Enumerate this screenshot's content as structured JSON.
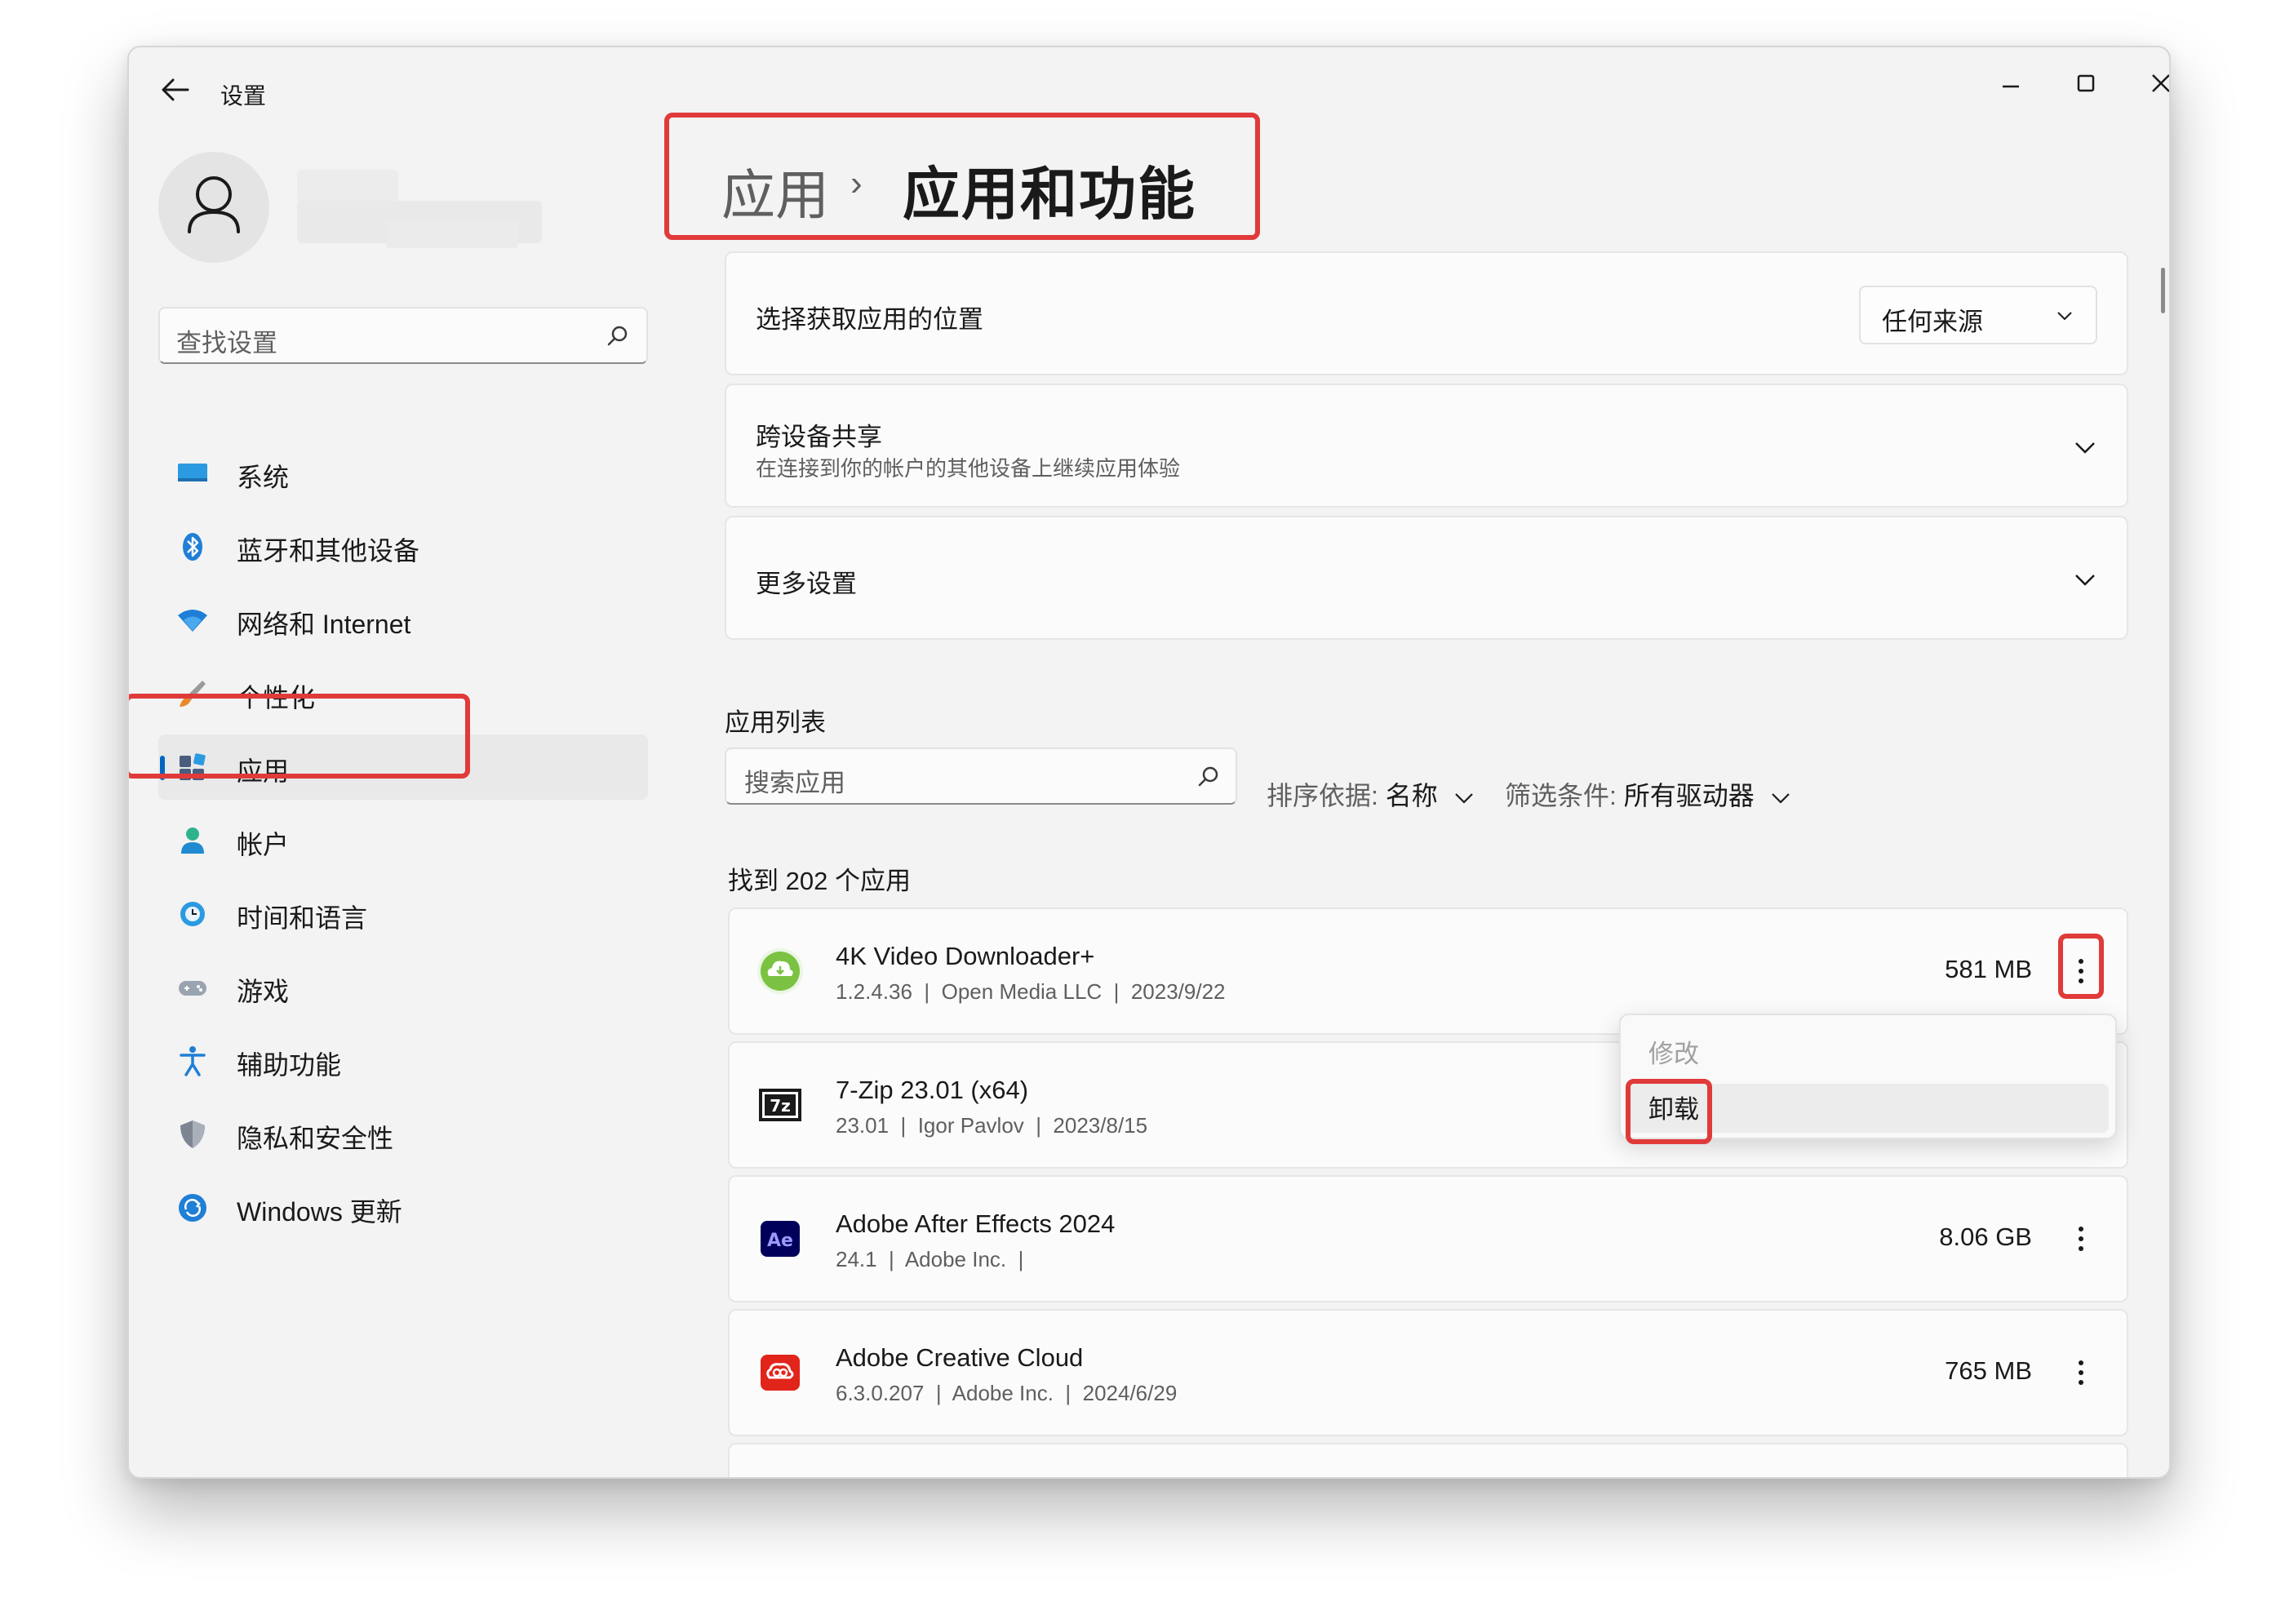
{
  "window": {
    "title": "设置"
  },
  "sidebar": {
    "search_placeholder": "查找设置",
    "items": [
      {
        "label": "系统",
        "icon": "monitor-icon"
      },
      {
        "label": "蓝牙和其他设备",
        "icon": "bluetooth-icon"
      },
      {
        "label": "网络和 Internet",
        "icon": "wifi-icon"
      },
      {
        "label": "个性化",
        "icon": "brush-icon"
      },
      {
        "label": "应用",
        "icon": "apps-icon",
        "selected": true
      },
      {
        "label": "帐户",
        "icon": "account-icon"
      },
      {
        "label": "时间和语言",
        "icon": "clock-globe-icon"
      },
      {
        "label": "游戏",
        "icon": "gamepad-icon"
      },
      {
        "label": "辅助功能",
        "icon": "accessibility-icon"
      },
      {
        "label": "隐私和安全性",
        "icon": "shield-icon"
      },
      {
        "label": "Windows 更新",
        "icon": "update-icon"
      }
    ]
  },
  "breadcrumb": {
    "parent": "应用",
    "separator": "›",
    "current": "应用和功能"
  },
  "settings": {
    "app_source": {
      "title": "选择获取应用的位置",
      "value": "任何来源"
    },
    "share": {
      "title": "跨设备共享",
      "subtitle": "在连接到你的帐户的其他设备上继续应用体验"
    },
    "more": {
      "title": "更多设置"
    }
  },
  "app_list": {
    "section_label": "应用列表",
    "search_placeholder": "搜索应用",
    "sort_label": "排序依据:",
    "sort_value": "名称",
    "filter_label": "筛选条件:",
    "filter_value": "所有驱动器",
    "count_text": "找到 202 个应用",
    "apps": [
      {
        "name": "4K Video Downloader+",
        "meta": "1.2.4.36  |  Open Media LLC  |  2023/9/22",
        "size": "581 MB",
        "icon": "cloud-download-icon"
      },
      {
        "name": "7-Zip 23.01 (x64)",
        "meta": "23.01  |  Igor Pavlov  |  2023/8/15",
        "size": "",
        "icon": "7zip-icon"
      },
      {
        "name": "Adobe After Effects 2024",
        "meta": "24.1  |  Adobe Inc.  |",
        "size": "8.06 GB",
        "icon": "after-effects-icon"
      },
      {
        "name": "Adobe Creative Cloud",
        "meta": "6.3.0.207  |  Adobe Inc.  |  2024/6/29",
        "size": "765 MB",
        "icon": "creative-cloud-icon"
      }
    ]
  },
  "context_menu": {
    "modify": "修改",
    "uninstall": "卸载"
  },
  "colors": {
    "accent": "#0067c0",
    "highlight": "#e03a3a",
    "window_bg": "#f3f3f3",
    "card_bg": "#fbfbfb"
  }
}
